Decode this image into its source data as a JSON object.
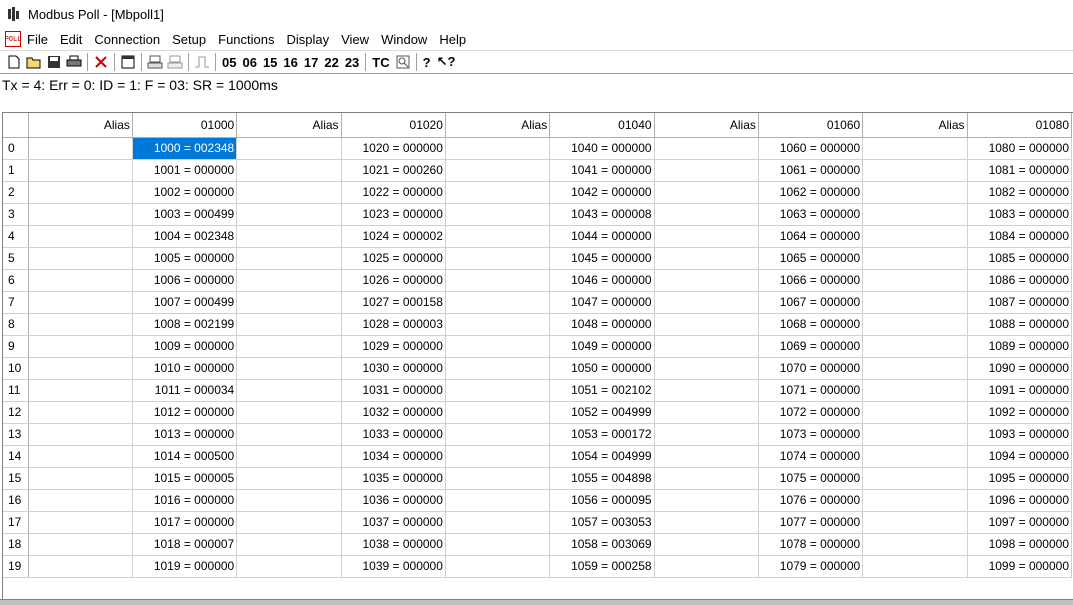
{
  "window": {
    "title": "Modbus Poll - [Mbpoll1]",
    "app_icon_text": "POLL"
  },
  "menu": [
    "File",
    "Edit",
    "Connection",
    "Setup",
    "Functions",
    "Display",
    "View",
    "Window",
    "Help"
  ],
  "toolbar": {
    "icons": [
      "new-document-icon",
      "open-folder-icon",
      "save-icon",
      "print-icon",
      "delete-icon",
      "window-icon",
      "read-icon",
      "write-icon",
      "pulse-icon"
    ],
    "function_codes": [
      "05",
      "06",
      "15",
      "16",
      "17",
      "22",
      "23"
    ],
    "tc_label": "TC",
    "help_icon": "help-icon",
    "context_help_icon": "context-help-icon"
  },
  "status": "Tx = 4: Err = 0: ID = 1: F = 03: SR = 1000ms",
  "grid": {
    "alias_header": "Alias",
    "column_headers": [
      "01000",
      "01020",
      "01040",
      "01060",
      "01080"
    ],
    "selected_cell": {
      "row": 0,
      "col": 0
    },
    "rows": [
      {
        "index": "0",
        "cells": [
          "1000 = 002348",
          "1020 = 000000",
          "1040 = 000000",
          "1060 = 000000",
          "1080 = 000000"
        ]
      },
      {
        "index": "1",
        "cells": [
          "1001 = 000000",
          "1021 = 000260",
          "1041 = 000000",
          "1061 = 000000",
          "1081 = 000000"
        ]
      },
      {
        "index": "2",
        "cells": [
          "1002 = 000000",
          "1022 = 000000",
          "1042 = 000000",
          "1062 = 000000",
          "1082 = 000000"
        ]
      },
      {
        "index": "3",
        "cells": [
          "1003 = 000499",
          "1023 = 000000",
          "1043 = 000008",
          "1063 = 000000",
          "1083 = 000000"
        ]
      },
      {
        "index": "4",
        "cells": [
          "1004 = 002348",
          "1024 = 000002",
          "1044 = 000000",
          "1064 = 000000",
          "1084 = 000000"
        ]
      },
      {
        "index": "5",
        "cells": [
          "1005 = 000000",
          "1025 = 000000",
          "1045 = 000000",
          "1065 = 000000",
          "1085 = 000000"
        ]
      },
      {
        "index": "6",
        "cells": [
          "1006 = 000000",
          "1026 = 000000",
          "1046 = 000000",
          "1066 = 000000",
          "1086 = 000000"
        ]
      },
      {
        "index": "7",
        "cells": [
          "1007 = 000499",
          "1027 = 000158",
          "1047 = 000000",
          "1067 = 000000",
          "1087 = 000000"
        ]
      },
      {
        "index": "8",
        "cells": [
          "1008 = 002199",
          "1028 = 000003",
          "1048 = 000000",
          "1068 = 000000",
          "1088 = 000000"
        ]
      },
      {
        "index": "9",
        "cells": [
          "1009 = 000000",
          "1029 = 000000",
          "1049 = 000000",
          "1069 = 000000",
          "1089 = 000000"
        ]
      },
      {
        "index": "10",
        "cells": [
          "1010 = 000000",
          "1030 = 000000",
          "1050 = 000000",
          "1070 = 000000",
          "1090 = 000000"
        ]
      },
      {
        "index": "11",
        "cells": [
          "1011 = 000034",
          "1031 = 000000",
          "1051 = 002102",
          "1071 = 000000",
          "1091 = 000000"
        ]
      },
      {
        "index": "12",
        "cells": [
          "1012 = 000000",
          "1032 = 000000",
          "1052 = 004999",
          "1072 = 000000",
          "1092 = 000000"
        ]
      },
      {
        "index": "13",
        "cells": [
          "1013 = 000000",
          "1033 = 000000",
          "1053 = 000172",
          "1073 = 000000",
          "1093 = 000000"
        ]
      },
      {
        "index": "14",
        "cells": [
          "1014 = 000500",
          "1034 = 000000",
          "1054 = 004999",
          "1074 = 000000",
          "1094 = 000000"
        ]
      },
      {
        "index": "15",
        "cells": [
          "1015 = 000005",
          "1035 = 000000",
          "1055 = 004898",
          "1075 = 000000",
          "1095 = 000000"
        ]
      },
      {
        "index": "16",
        "cells": [
          "1016 = 000000",
          "1036 = 000000",
          "1056 = 000095",
          "1076 = 000000",
          "1096 = 000000"
        ]
      },
      {
        "index": "17",
        "cells": [
          "1017 = 000000",
          "1037 = 000000",
          "1057 = 003053",
          "1077 = 000000",
          "1097 = 000000"
        ]
      },
      {
        "index": "18",
        "cells": [
          "1018 = 000007",
          "1038 = 000000",
          "1058 = 003069",
          "1078 = 000000",
          "1098 = 000000"
        ]
      },
      {
        "index": "19",
        "cells": [
          "1019 = 000000",
          "1039 = 000000",
          "1059 = 000258",
          "1079 = 000000",
          "1099 = 000000"
        ]
      }
    ]
  },
  "colors": {
    "selection": "#0078d7",
    "grid_line": "#d0d0d0"
  }
}
